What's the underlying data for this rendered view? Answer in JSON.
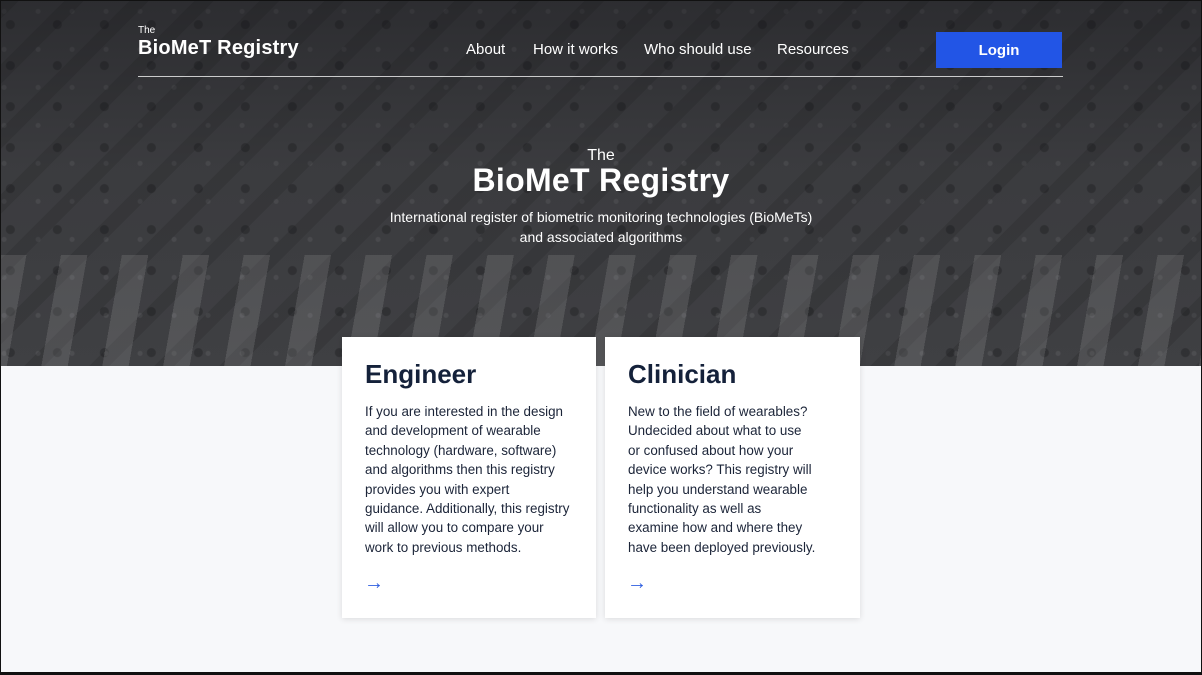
{
  "brand": {
    "prefix": "The",
    "name": "BioMeT Registry"
  },
  "nav": {
    "items": [
      "About",
      "How it works",
      "Who should use",
      "Resources"
    ],
    "login_label": "Login"
  },
  "hero": {
    "prefix": "The",
    "title": "BioMeT Registry",
    "subtitle_line1": "International register of biometric monitoring technologies (BioMeTs)",
    "subtitle_line2": "and associated algorithms"
  },
  "cards": [
    {
      "title": "Engineer",
      "lines": [
        "If you are interested in the design",
        "and development of wearable",
        "technology (hardware, software)",
        "and algorithms then this registry",
        "provides you with expert",
        "guidance. Additionally, this registry",
        "will allow you to compare your",
        "work to previous methods."
      ],
      "arrow": "→"
    },
    {
      "title": "Clinician",
      "lines": [
        "New to the field of wearables?",
        "Undecided about what to use",
        "or confused about how your",
        "device works? This registry will",
        "help you understand wearable",
        "functionality as well as",
        "examine how and where they",
        "have been deployed previously."
      ],
      "arrow": "→"
    }
  ],
  "colors": {
    "accent": "#2255e6",
    "heading": "#14213a",
    "page_bg": "#f7f8fa"
  }
}
